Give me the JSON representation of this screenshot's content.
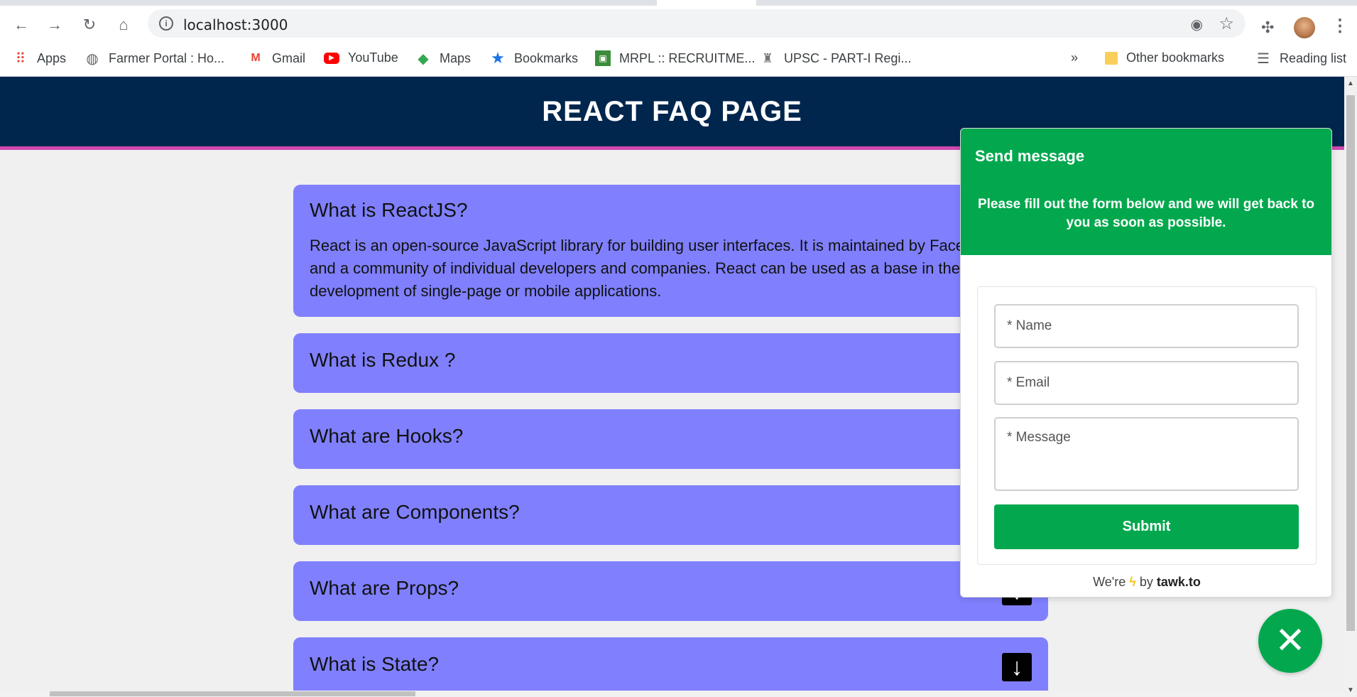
{
  "browser": {
    "url": "localhost:3000",
    "bookmarks": [
      {
        "label": "Apps",
        "icon": "apps-grid-icon"
      },
      {
        "label": "Farmer Portal : Ho...",
        "icon": "globe-icon"
      },
      {
        "label": "Gmail",
        "icon": "gmail-icon"
      },
      {
        "label": "YouTube",
        "icon": "youtube-icon"
      },
      {
        "label": "Maps",
        "icon": "maps-icon"
      },
      {
        "label": "Bookmarks",
        "icon": "star-icon"
      },
      {
        "label": "MRPL :: RECRUITME...",
        "icon": "mrpl-icon"
      },
      {
        "label": "UPSC - PART-I Regi...",
        "icon": "emblem-icon"
      }
    ],
    "overflow": "»",
    "other_bookmarks": "Other bookmarks",
    "reading_list": "Reading list"
  },
  "page": {
    "title": "REACT FAQ PAGE",
    "faqs": [
      {
        "question": "What is ReactJS?",
        "answer": "React is an open-source JavaScript library for building user interfaces. It is maintained by Facebook and a community of individual developers and companies. React can be used as a base in the development of single-page or mobile applications."
      },
      {
        "question": "What is Redux ?"
      },
      {
        "question": "What are Hooks?"
      },
      {
        "question": "What are Components?"
      },
      {
        "question": "What are Props?"
      },
      {
        "question": "What is State?"
      }
    ]
  },
  "chat": {
    "title": "Send message",
    "subtitle": "Please fill out the form below and we will get back to you as soon as possible.",
    "name_placeholder": "* Name",
    "email_placeholder": "* Email",
    "message_placeholder": "* Message",
    "submit_label": "Submit",
    "footer_prefix": "We're",
    "footer_by": "by",
    "footer_brand": "tawk.to",
    "accent": "#03a84e"
  },
  "colors": {
    "header_bg": "#00264d",
    "header_border": "#d048b0",
    "faq_bg": "#8080ff"
  }
}
